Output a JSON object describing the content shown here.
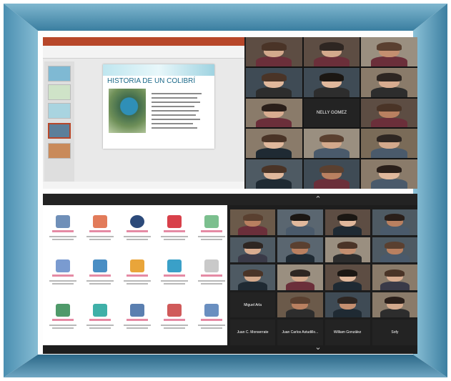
{
  "slide": {
    "heading": "HISTORIA DE UN COLIBRÍ"
  },
  "participants_top": [
    {
      "kind": "video"
    },
    {
      "kind": "video"
    },
    {
      "kind": "video"
    },
    {
      "kind": "video"
    },
    {
      "kind": "video"
    },
    {
      "kind": "video"
    },
    {
      "kind": "video"
    },
    {
      "kind": "name",
      "name": "NELLY GOMEZ"
    },
    {
      "kind": "video"
    },
    {
      "kind": "video"
    },
    {
      "kind": "video"
    },
    {
      "kind": "video"
    },
    {
      "kind": "video"
    },
    {
      "kind": "video"
    },
    {
      "kind": "video"
    }
  ],
  "participants_bottom": [
    {
      "kind": "video"
    },
    {
      "kind": "video"
    },
    {
      "kind": "video"
    },
    {
      "kind": "video"
    },
    {
      "kind": "video"
    },
    {
      "kind": "video"
    },
    {
      "kind": "video"
    },
    {
      "kind": "video"
    },
    {
      "kind": "video"
    },
    {
      "kind": "video"
    },
    {
      "kind": "video"
    },
    {
      "kind": "video"
    },
    {
      "kind": "name",
      "name": "Miguel Arla"
    },
    {
      "kind": "video"
    },
    {
      "kind": "video"
    },
    {
      "kind": "video"
    },
    {
      "kind": "name",
      "name": "Juan C. Monserrate"
    },
    {
      "kind": "name",
      "name": "Juan Carlos Astudillo..."
    },
    {
      "kind": "name",
      "name": "William González"
    },
    {
      "kind": "name",
      "name": "Sofy"
    }
  ],
  "colors": {
    "frame_light": "#86bcd3",
    "frame_dark": "#2b6787",
    "app_label": "#d0305a",
    "ppt_accent": "#b7472a"
  }
}
